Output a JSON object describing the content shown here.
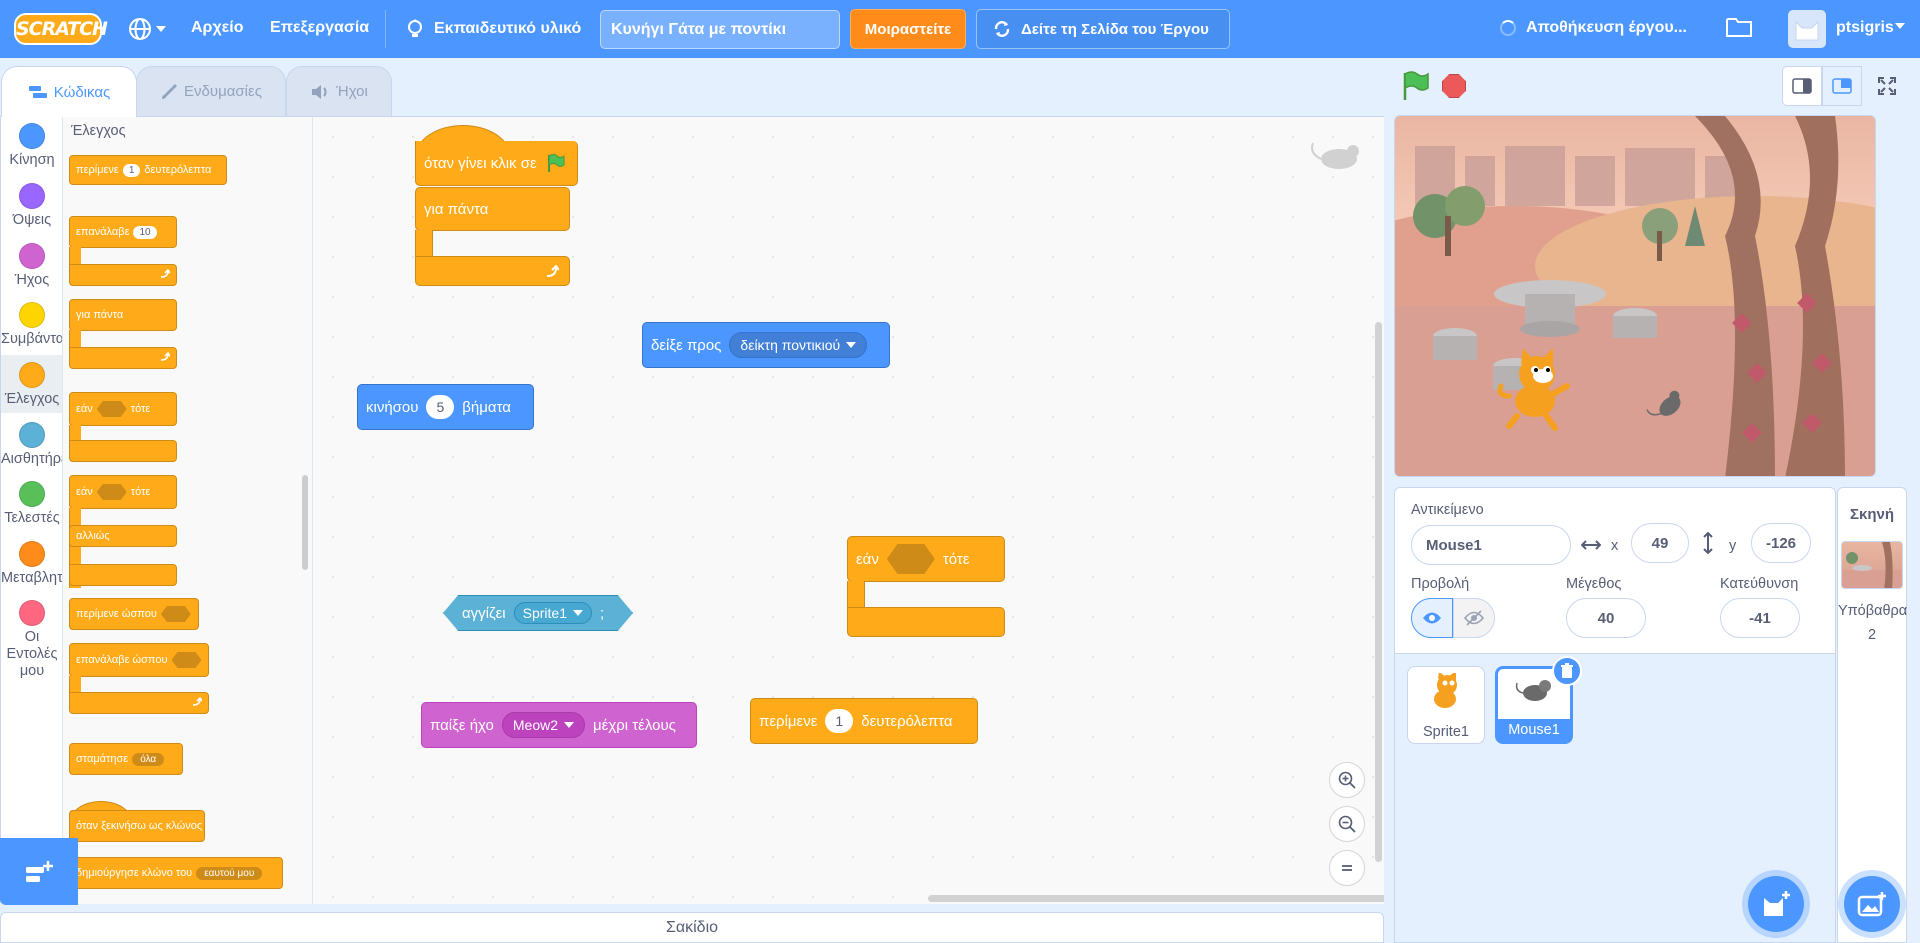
{
  "menubar": {
    "logo": "SCRATCH",
    "file": "Αρχείο",
    "edit": "Επεξεργασία",
    "tutorials": "Εκπαιδευτικό υλικό",
    "project_title": "Κυνήγι Γάτα με ποντίκι",
    "share": "Μοιραστείτε",
    "see_project_page": "Δείτε τη Σελίδα του Έργου",
    "saving_status": "Αποθήκευση έργου...",
    "username": "ptsigris"
  },
  "tabs": [
    {
      "label": "Κώδικας"
    },
    {
      "label": "Ενδυμασίες"
    },
    {
      "label": "Ήχοι"
    }
  ],
  "categories": [
    {
      "label": "Κίνηση",
      "color": "#4c97ff"
    },
    {
      "label": "Όψεις",
      "color": "#9966ff"
    },
    {
      "label": "Ήχος",
      "color": "#cf63cf"
    },
    {
      "label": "Συμβάντα",
      "color": "#ffd500"
    },
    {
      "label": "Έλεγχος",
      "color": "#ffab19"
    },
    {
      "label": "Αισθητήρες",
      "color": "#5cb1d6"
    },
    {
      "label": "Τελεστές",
      "color": "#59c059"
    },
    {
      "label": "Μεταβλητές",
      "color": "#ff8c1a"
    },
    {
      "label": "Οι Εντολές μου",
      "color": "#ff6680"
    }
  ],
  "flyout": {
    "title": "Έλεγχος",
    "wait": {
      "label": "περίμενε",
      "value": "1",
      "unit": "δευτερόλεπτα"
    },
    "repeat": {
      "label": "επανάλαβε",
      "value": "10"
    },
    "forever": {
      "label": "για πάντα"
    },
    "if_then": {
      "if": "εάν",
      "then": "τότε"
    },
    "if_else": {
      "if": "εάν",
      "then": "τότε",
      "else": "αλλιώς"
    },
    "wait_until": {
      "label": "περίμενε ώσπου"
    },
    "repeat_until": {
      "label": "επανάλαβε ώσπου"
    },
    "stop": {
      "label": "σταμάτησε",
      "value": "όλα"
    },
    "clone_start": {
      "label": "όταν ξεκινήσω ως κλώνος"
    },
    "create_clone": {
      "label": "δημιούργησε κλώνο του",
      "value": "εαυτού μου"
    }
  },
  "workspace": {
    "hat": {
      "label": "όταν γίνει κλικ σε"
    },
    "forever": {
      "label": "για πάντα"
    },
    "point_towards": {
      "label": "δείξε προς",
      "value": "δείκτη ποντικιού"
    },
    "move": {
      "label": "κινήσου",
      "value": "5",
      "unit": "βήματα"
    },
    "if_then": {
      "if": "εάν",
      "then": "τότε"
    },
    "touching": {
      "label": "αγγίζει",
      "value": "Sprite1",
      "suffix": ";"
    },
    "play_sound": {
      "label": "παίξε ήχο",
      "value": "Meow2",
      "suffix": "μέχρι τέλους"
    },
    "wait": {
      "label": "περίμενε",
      "value": "1",
      "unit": "δευτερόλεπτα"
    }
  },
  "backpack": {
    "label": "Σακίδιο"
  },
  "sprite_info": {
    "sprite_label": "Αντικείμενο",
    "sprite_name": "Mouse1",
    "x_label": "x",
    "x_value": "49",
    "y_label": "y",
    "y_value": "-126",
    "show_label": "Προβολή",
    "size_label": "Μέγεθος",
    "size_value": "40",
    "direction_label": "Κατεύθυνση",
    "direction_value": "-41"
  },
  "sprites": [
    {
      "name": "Sprite1"
    },
    {
      "name": "Mouse1",
      "selected": true
    }
  ],
  "stage_panel": {
    "header": "Σκηνή",
    "backdrops_label": "Υπόβαθρα",
    "backdrops_count": "2"
  },
  "colors": {
    "menu_blue": "#4c97ff",
    "control_orange": "#ffab19",
    "share_orange": "#ff8c1a"
  }
}
